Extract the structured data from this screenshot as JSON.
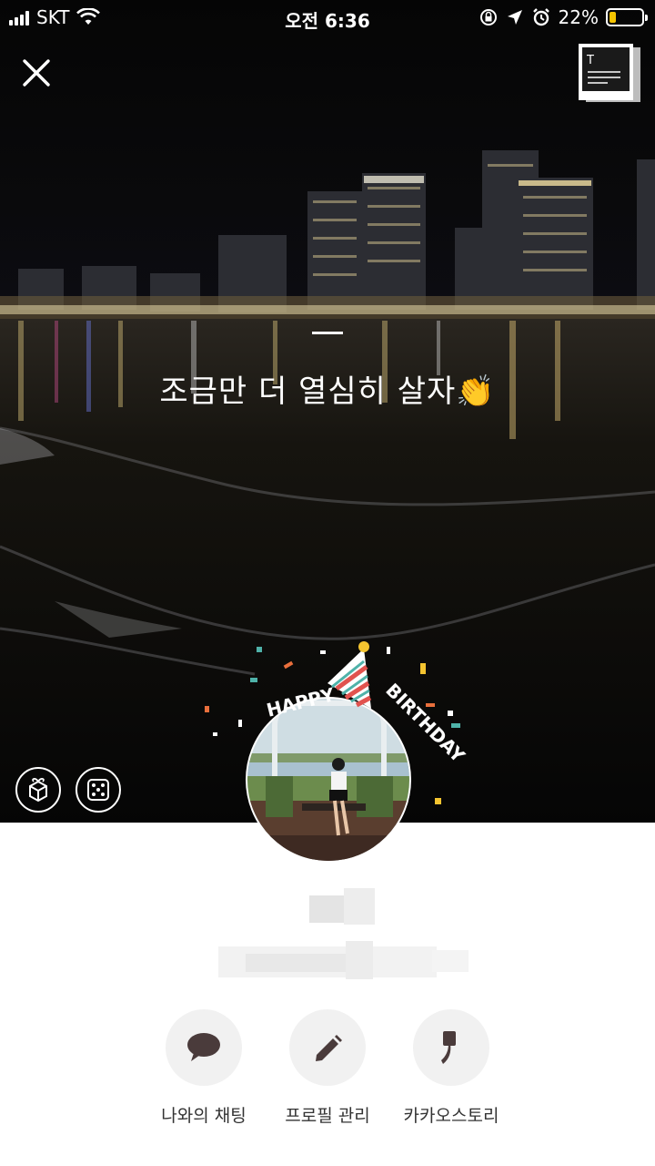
{
  "status_bar": {
    "carrier": "SKT",
    "time": "오전 6:36",
    "battery_percent_text": "22%",
    "battery_level": 0.22,
    "battery_color": "#f5c400"
  },
  "header": {
    "close_icon": "close-icon",
    "story_icon": "text-story-icon"
  },
  "profile": {
    "status_message": "조금만 더 열심히 살자",
    "status_emoji": "👏",
    "sticker_text_left": "HAPPY",
    "sticker_text_right": "BIRTHDAY"
  },
  "scene_buttons": {
    "gift_icon": "gift-icon",
    "dice_icon": "dice-icon"
  },
  "actions": [
    {
      "label": "나와의 채팅",
      "icon": "chat-bubble-icon"
    },
    {
      "label": "프로필 관리",
      "icon": "pencil-icon"
    },
    {
      "label": "카카오스토리",
      "icon": "kakaostory-icon"
    }
  ],
  "colors": {
    "sheet": "#ffffff",
    "action_circle": "#f1f1f1",
    "action_icon": "#4a3b3b"
  }
}
